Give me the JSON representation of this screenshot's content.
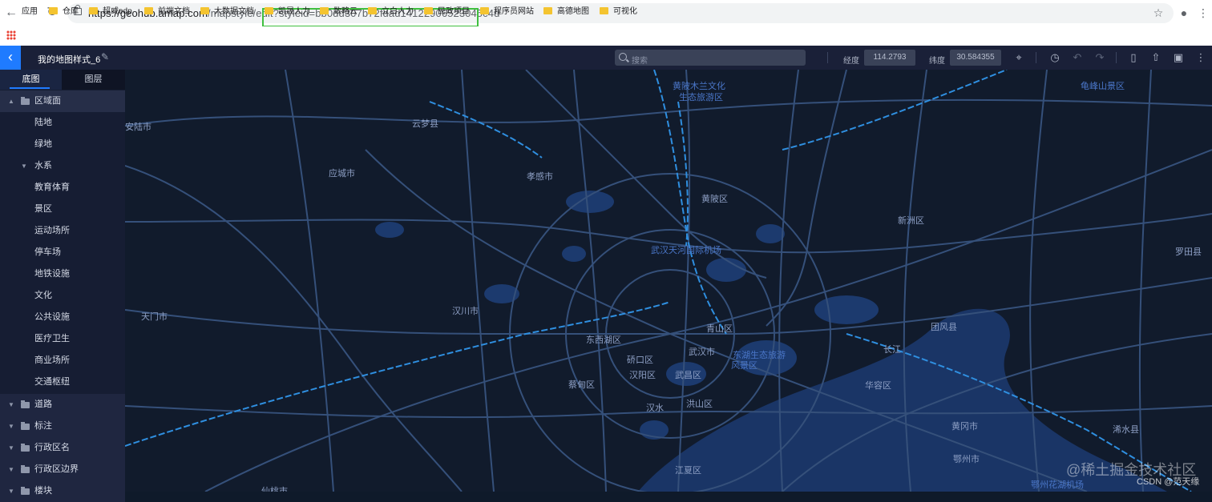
{
  "browser": {
    "url_host": "https://geohub.amap.com",
    "url_path": "/mapstyle/edit?styleid=bb0dd307b72fdad1412290652304 5c4d",
    "url_full": "https://geohub.amap.com/mapstyle/edit?styleid=bb0dd307b72fdad14122906523045c4d",
    "back_icon": "arrow-left-icon",
    "forward_icon": "arrow-right-icon",
    "reload_icon": "reload-icon"
  },
  "bookmarks": {
    "apps_label": "应用",
    "items": [
      "仓库",
      "超威edp",
      "前端文档",
      "大数据文档",
      "凯晟人力",
      "数略云",
      "立白人力",
      "民政项目",
      "程序员网站",
      "高德地图",
      "可视化"
    ]
  },
  "header": {
    "map_title": "我的地图样式_6",
    "search_placeholder": "搜索",
    "lng_label": "经度",
    "lng_value": "114.2793",
    "lat_label": "纬度",
    "lat_value": "30.584355"
  },
  "sidebar": {
    "tabs": [
      "底图",
      "图层"
    ],
    "active_tab": "底图",
    "groups": [
      {
        "label": "区域面",
        "expanded": true
      },
      {
        "label": "道路",
        "expanded": false
      },
      {
        "label": "标注",
        "expanded": false
      },
      {
        "label": "行政区名",
        "expanded": false
      },
      {
        "label": "行政区边界",
        "expanded": false
      },
      {
        "label": "楼块",
        "expanded": false
      }
    ],
    "region_children": [
      "陆地",
      "绿地",
      "水系",
      "教育体育",
      "景区",
      "运动场所",
      "停车场",
      "地铁设施",
      "文化",
      "公共设施",
      "医疗卫生",
      "商业场所",
      "交通枢纽"
    ]
  },
  "map": {
    "labels": [
      "黄陂木兰文化",
      "生态旅游区",
      "龟峰山景区",
      "安陆市",
      "云梦县",
      "应城市",
      "孝感市",
      "黄陂区",
      "新洲区",
      "罗田县",
      "武汉天河国际机场",
      "天门市",
      "汉川市",
      "东西湖区",
      "青山区",
      "团风县",
      "硚口区",
      "武汉市",
      "东湖生态旅游",
      "风景区",
      "长江",
      "汉阳区",
      "武昌区",
      "蔡甸区",
      "华容区",
      "洪山区",
      "汉水",
      "黄冈市",
      "浠水县",
      "鄂州市",
      "江夏区",
      "鄂州花湖机场",
      "仙桃市"
    ],
    "colors": {
      "background": "#111b2c",
      "road": "#35507a",
      "highway": "#2f8fe0",
      "water": "#1c3a6e"
    }
  },
  "watermark": {
    "text": "@稀土掘金技术社区",
    "csdn": "CSDN @范天缘"
  }
}
